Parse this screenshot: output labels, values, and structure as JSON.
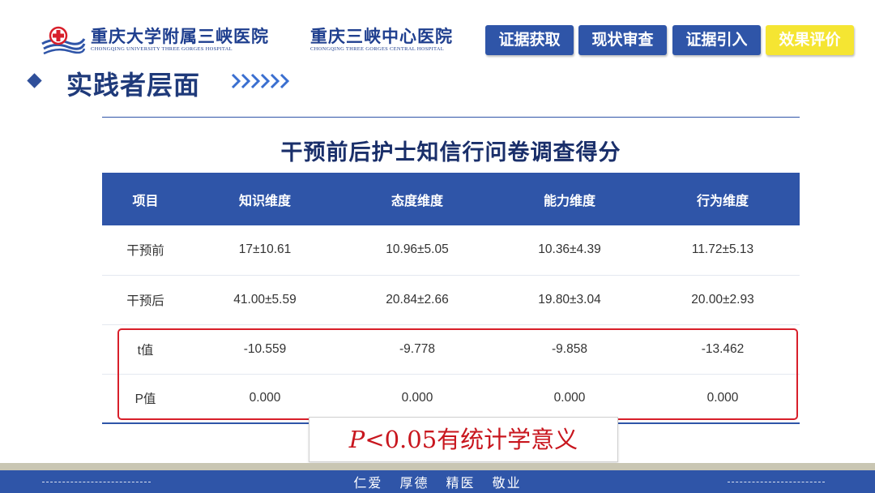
{
  "header": {
    "hospital1": {
      "name": "重庆大学附属三峡医院",
      "english": "CHONGQING UNIVERSITY THREE GORGES HOSPITAL"
    },
    "hospital2": {
      "name": "重庆三峡中心医院",
      "english": "CHONGQING THREE GORGES CENTRAL HOSPITAL"
    },
    "nav": [
      "证据获取",
      "现状审查",
      "证据引入",
      "效果评价"
    ],
    "active_nav": "效果评价"
  },
  "section": {
    "title": "实践者层面"
  },
  "table": {
    "title": "干预前后护士知信行问卷调查得分",
    "headers": [
      "项目",
      "知识维度",
      "态度维度",
      "能力维度",
      "行为维度"
    ],
    "rows": [
      [
        "干预前",
        "17±10.61",
        "10.96±5.05",
        "10.36±4.39",
        "11.72±5.13"
      ],
      [
        "干预后",
        "41.00±5.59",
        "20.84±2.66",
        "19.80±3.04",
        "20.00±2.93"
      ],
      [
        "t值",
        "-10.559",
        "-9.778",
        "-9.858",
        "-13.462"
      ],
      [
        "P值",
        "0.000",
        "0.000",
        "0.000",
        "0.000"
      ]
    ]
  },
  "note": {
    "p": "P",
    "rest": "<0.05有统计学意义"
  },
  "footer": {
    "motto": "仁爱 厚德 精医 敬业"
  },
  "colors": {
    "primary": "#2f55a8",
    "highlight": "#d81f2a",
    "active_nav": "#f5e532"
  }
}
